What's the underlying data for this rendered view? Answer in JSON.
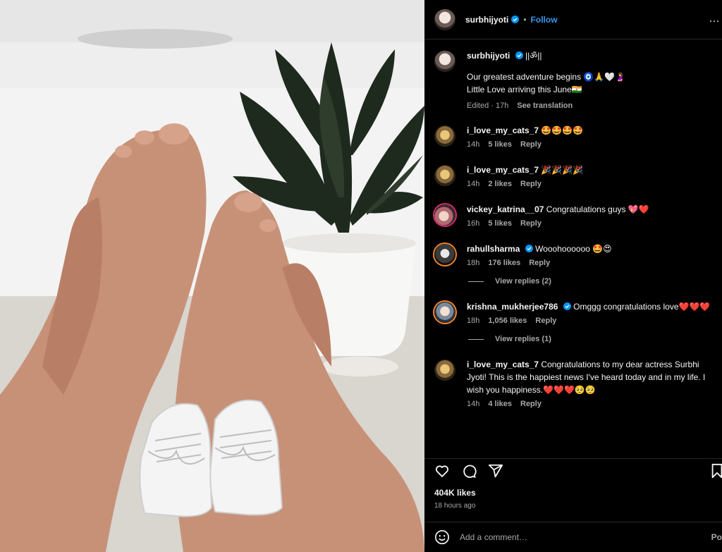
{
  "header": {
    "username": "surbhijyoti",
    "follow_label": "Follow",
    "more": "…"
  },
  "caption": {
    "username": "surbhijyoti",
    "name_suffix": "||ॐ||",
    "line1": "Our greatest adventure begins 🧿🙏🤍🤰",
    "line2": "Little Love arriving this June🇮🇳",
    "edited": "Edited · 17h",
    "see_translation": "See translation"
  },
  "comments": [
    {
      "user": "i_love_my_cats_7",
      "text": "🤩🤩🤩🤩",
      "time": "14h",
      "likes": "5 likes",
      "reply": "Reply"
    },
    {
      "user": "i_love_my_cats_7",
      "text": "🎉🎉🎉🎉",
      "time": "14h",
      "likes": "2 likes",
      "reply": "Reply"
    },
    {
      "user": "vickey_katrina__07",
      "text": "Congratulations guys 💖❤️",
      "time": "16h",
      "likes": "5 likes",
      "reply": "Reply"
    },
    {
      "user": "rahullsharma",
      "text": "Wooohoooooo 🤩😍",
      "time": "18h",
      "likes": "176 likes",
      "reply": "Reply",
      "view_replies": "View replies (2)"
    },
    {
      "user": "krishna_mukherjee786",
      "text": "Omggg congratulations love❤️❤️❤️",
      "time": "18h",
      "likes": "1,056 likes",
      "reply": "Reply",
      "view_replies": "View replies (1)"
    },
    {
      "user": "i_love_my_cats_7",
      "text": "Congratulations to my dear actress Surbhi Jyoti! This is the happiest news I've heard today and in my life. I wish you happiness.❤️❤️❤️🥺🥺",
      "time": "14h",
      "likes": "4 likes",
      "reply": "Reply"
    }
  ],
  "actions": {
    "likes": "404K likes",
    "posted_ago": "18 hours ago"
  },
  "add_comment": {
    "placeholder": "Add a comment…",
    "post_label": "Po"
  },
  "colors": {
    "panel_bg": "#000000",
    "link_blue": "#3897f0",
    "muted": "#a8a8a8",
    "verified_blue": "#0095f6"
  }
}
